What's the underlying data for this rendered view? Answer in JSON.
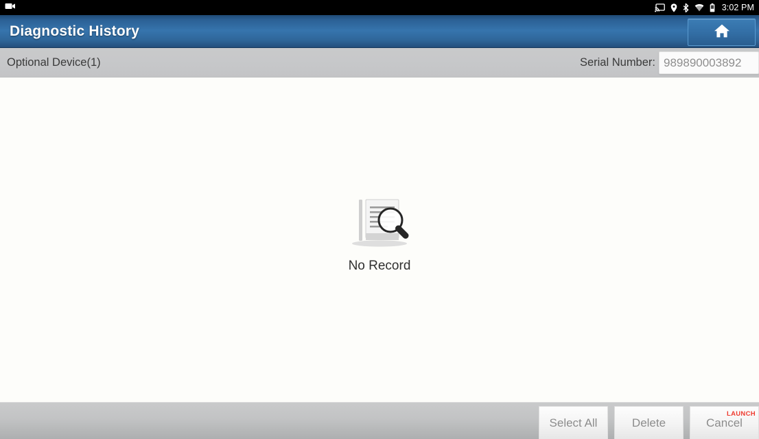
{
  "statusbar": {
    "left_icons": [
      {
        "name": "camcorder-icon",
        "label": "camcorder"
      }
    ],
    "right_icons": [
      {
        "name": "cast-icon",
        "label": "cast"
      },
      {
        "name": "location-pin-icon",
        "label": "location"
      },
      {
        "name": "bluetooth-icon",
        "label": "bluetooth"
      },
      {
        "name": "wifi-icon",
        "label": "wifi"
      },
      {
        "name": "battery-icon",
        "label": "battery"
      }
    ],
    "time": "3:02 PM",
    "background": "#000000"
  },
  "titlebar": {
    "title": "Diagnostic History",
    "home_icon": "home-icon",
    "accent": "#3674ad"
  },
  "subheader": {
    "optional_device": "Optional Device(1)",
    "serial_label": "Serial Number:",
    "serial_value": "989890003892",
    "background": "#c6c7c9"
  },
  "content": {
    "empty_state": {
      "icon": "no-record-document-search-icon",
      "label": "No Record"
    },
    "background": "#fdfdfa"
  },
  "footer": {
    "buttons": [
      {
        "name": "select-all-button",
        "label": "Select All"
      },
      {
        "name": "delete-button",
        "label": "Delete"
      },
      {
        "name": "cancel-button",
        "label": "Cancel"
      }
    ],
    "watermark": "LAUNCH",
    "watermark_color": "#ee2b1e"
  }
}
